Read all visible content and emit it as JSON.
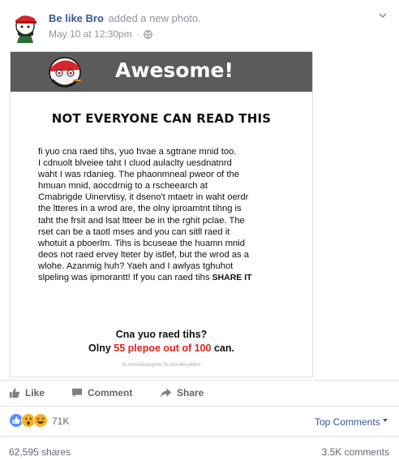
{
  "post": {
    "author": "Be like Bro",
    "action": "added a new photo.",
    "date": "May 10 at 12:30pm",
    "separator": "·"
  },
  "photo": {
    "banner_text": "Awesome!",
    "headline": "NOT EVERYONE CAN READ THIS",
    "paragraph_lines": [
      "fi yuo cna raed tihs, yuo hvae a sgtrane mnid too.",
      "I cdnuolt blveiee taht I cluod aulaclty uesdnatnrd",
      "waht I was rdanieg. The phaonmneal pweor of the",
      "hmuan mnid, aoccdrnig to a rscheearch at",
      "Cmabrigde Uinervtisy, it dseno't mtaetr in waht oerdr",
      "the ltteres in a wrod are, the olny iproamtnt tihng is",
      "taht the frsit and lsat ltteer be in the rghit pclae. The",
      "rset can be a taotl mses and you can sitll raed it",
      "whotuit a pboerlm. Tihs is bcuseae the huamn mnid",
      "deos not raed ervey lteter by istlef, but the wrod as a",
      "wlohe. Azanmig huh? Yaeh and I awlyas tghuhot",
      "slpeling was ipmorantt! If you can raed tihs"
    ],
    "share_it": "SHARE IT",
    "question": "Cna yuo raed tihs?",
    "answer_prefix": "Olny ",
    "answer_highlight": "55 plepoe out of 100",
    "answer_suffix": " can.",
    "credit": "fb.com/dielaughter  fb.com/BeLykBro"
  },
  "actions": {
    "like": "Like",
    "comment": "Comment",
    "share": "Share"
  },
  "reactions": {
    "count": "71K",
    "icons": [
      "like-reaction",
      "wow-reaction",
      "haha-reaction"
    ],
    "top_comments": "Top Comments"
  },
  "stats": {
    "shares": "62,595 shares",
    "comments": "3.5K comments"
  },
  "colors": {
    "link": "#365899",
    "muted": "#90949c",
    "banner": "#5b5b5b",
    "highlight_red": "#e1241b",
    "like_blue": "#5890ff",
    "reaction_yellow": "#f7b125"
  }
}
